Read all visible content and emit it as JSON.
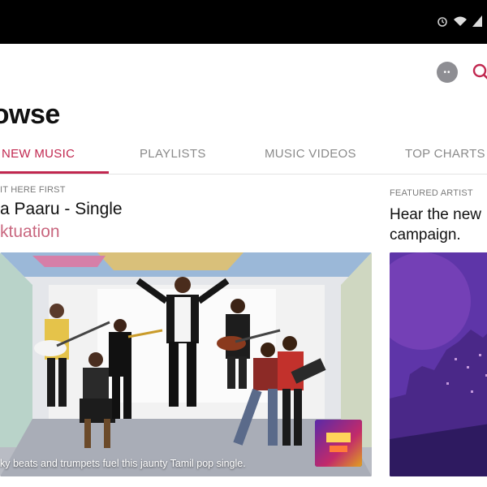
{
  "app": {
    "title": "rowse"
  },
  "status_bar": {
    "icons": [
      "alarm-icon",
      "wifi-icon",
      "signal-icon"
    ]
  },
  "header": {
    "avatar_text": "••",
    "search_icon": "search-icon"
  },
  "tabs": [
    {
      "label": "NEW MUSIC",
      "active": true
    },
    {
      "label": "PLAYLISTS",
      "active": false
    },
    {
      "label": "MUSIC VIDEOS",
      "active": false
    },
    {
      "label": "TOP CHARTS",
      "active": false
    }
  ],
  "feature_left": {
    "eyebrow": "IT HERE FIRST",
    "title": "a Paaru - Single",
    "subtitle": "ktuation",
    "caption": "ky beats and trumpets fuel this jaunty Tamil pop single."
  },
  "feature_right": {
    "eyebrow": "FEATURED ARTIST",
    "title": "Hear the new",
    "subtitle": "campaign."
  },
  "colors": {
    "accent": "#c1274f",
    "accent_light": "#c9677f"
  }
}
